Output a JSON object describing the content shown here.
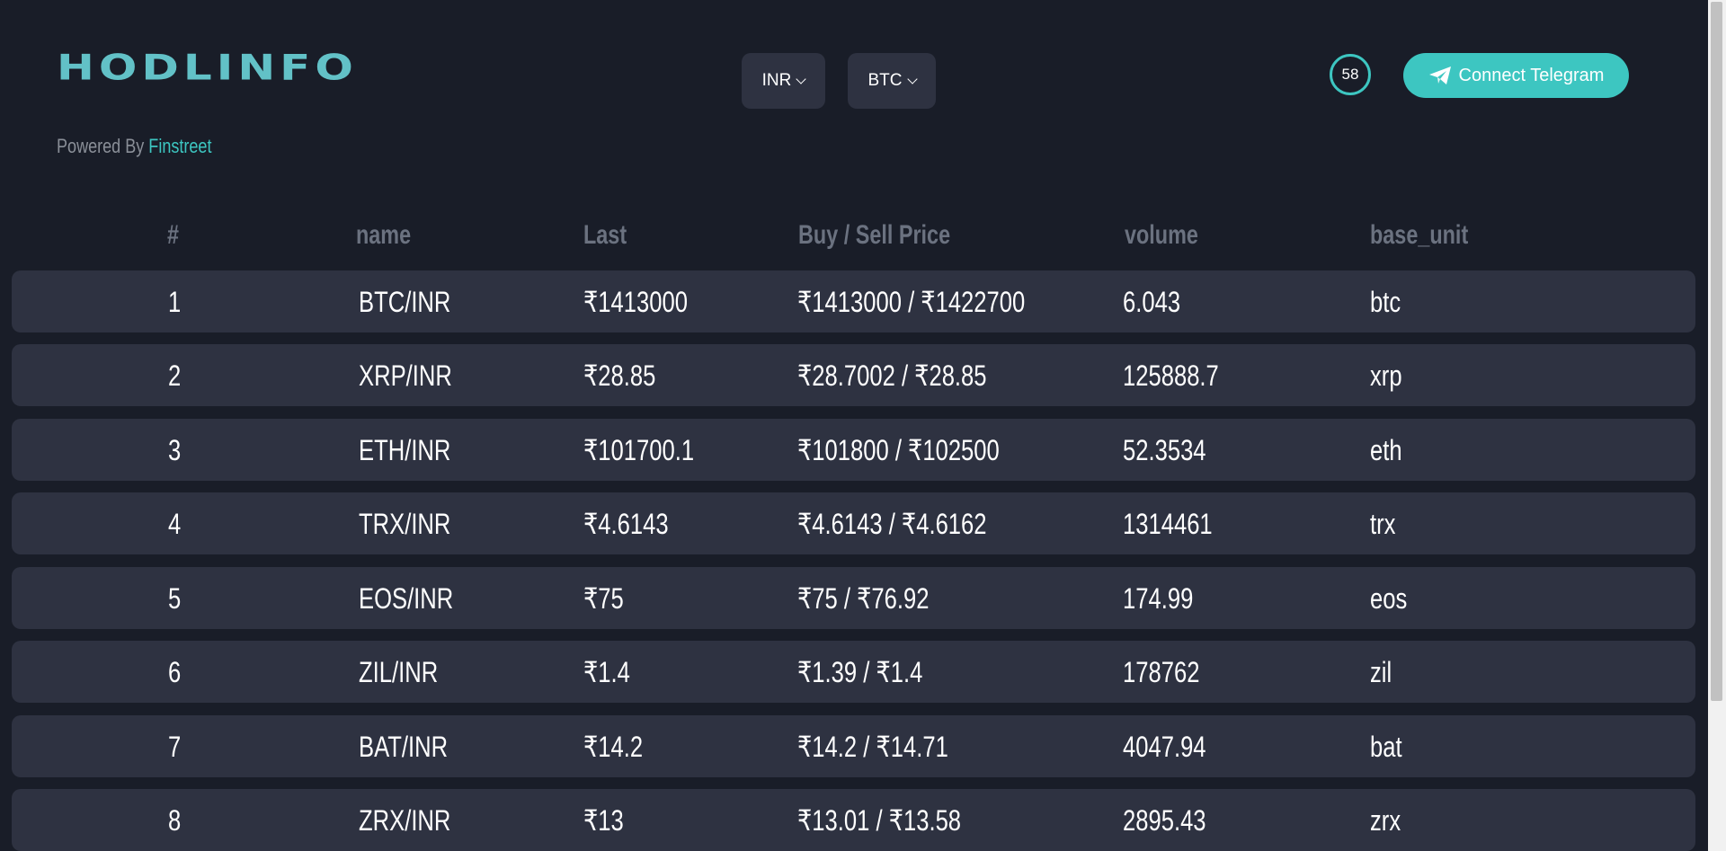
{
  "header": {
    "logo": "HODLINFO",
    "powered_prefix": "Powered By",
    "powered_brand": "Finstreet",
    "currency_select": "INR",
    "coin_select": "BTC",
    "timer": "58",
    "telegram_button": "Connect Telegram"
  },
  "colors": {
    "accent": "#3dc6c1",
    "logo": "#62c1c7",
    "background": "#191d28",
    "row_background": "#2e3241",
    "header_text": "#6b7280"
  },
  "icons": {
    "telegram": "paper-plane-icon",
    "dropdown": "chevron-down-icon"
  },
  "table": {
    "columns": [
      "#",
      "name",
      "Last",
      "Buy / Sell Price",
      "volume",
      "base_unit"
    ],
    "rows": [
      {
        "num": "1",
        "name": "BTC/INR",
        "last": "₹1413000",
        "buy_sell": "₹1413000 / ₹1422700",
        "volume": "6.043",
        "unit": "btc"
      },
      {
        "num": "2",
        "name": "XRP/INR",
        "last": "₹28.85",
        "buy_sell": "₹28.7002 / ₹28.85",
        "volume": "125888.7",
        "unit": "xrp"
      },
      {
        "num": "3",
        "name": "ETH/INR",
        "last": "₹101700.1",
        "buy_sell": "₹101800 / ₹102500",
        "volume": "52.3534",
        "unit": "eth"
      },
      {
        "num": "4",
        "name": "TRX/INR",
        "last": "₹4.6143",
        "buy_sell": "₹4.6143 / ₹4.6162",
        "volume": "1314461",
        "unit": "trx"
      },
      {
        "num": "5",
        "name": "EOS/INR",
        "last": "₹75",
        "buy_sell": "₹75 / ₹76.92",
        "volume": "174.99",
        "unit": "eos"
      },
      {
        "num": "6",
        "name": "ZIL/INR",
        "last": "₹1.4",
        "buy_sell": "₹1.39 / ₹1.4",
        "volume": "178762",
        "unit": "zil"
      },
      {
        "num": "7",
        "name": "BAT/INR",
        "last": "₹14.2",
        "buy_sell": "₹14.2 / ₹14.71",
        "volume": "4047.94",
        "unit": "bat"
      },
      {
        "num": "8",
        "name": "ZRX/INR",
        "last": "₹13",
        "buy_sell": "₹13.01 / ₹13.58",
        "volume": "2895.43",
        "unit": "zrx"
      }
    ]
  }
}
